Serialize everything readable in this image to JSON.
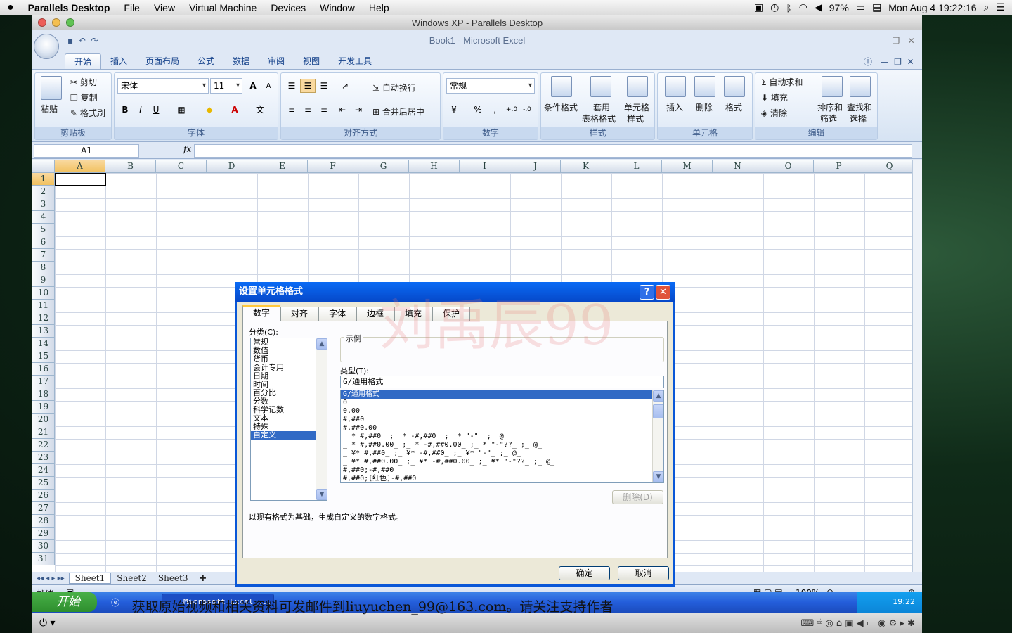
{
  "mac_menubar": {
    "app": "Parallels Desktop",
    "items": [
      "File",
      "View",
      "Virtual Machine",
      "Devices",
      "Window",
      "Help"
    ],
    "battery": "97%",
    "datetime": "Mon Aug 4  19:22:16"
  },
  "parallels": {
    "window_title": "Windows XP - Parallels Desktop"
  },
  "excel": {
    "title": "Book1 - Microsoft Excel",
    "tabs": [
      "开始",
      "插入",
      "页面布局",
      "公式",
      "数据",
      "审阅",
      "视图",
      "开发工具"
    ],
    "ribbon": {
      "clipboard": {
        "label": "剪贴板",
        "paste": "粘贴",
        "cut": "剪切",
        "copy": "复制",
        "format_painter": "格式刷"
      },
      "font": {
        "label": "字体",
        "family": "宋体",
        "size": "11",
        "bold": "B",
        "italic": "I",
        "underline": "U",
        "grow": "A",
        "shrink": "A"
      },
      "alignment": {
        "label": "对齐方式",
        "wrap": "自动换行",
        "merge": "合并后居中"
      },
      "number": {
        "label": "数字",
        "format": "常规",
        "percent": "%",
        "comma": ","
      },
      "styles": {
        "label": "样式",
        "conditional": "条件格式",
        "table_top": "套用",
        "table_bottom": "表格格式",
        "cell_top": "单元格",
        "cell_bottom": "样式"
      },
      "cells": {
        "label": "单元格",
        "insert": "插入",
        "delete": "删除",
        "format": "格式"
      },
      "editing": {
        "label": "编辑",
        "autosum": "自动求和",
        "fill": "填充",
        "clear": "清除",
        "sort_top": "排序和",
        "sort_bottom": "筛选",
        "find_top": "查找和",
        "find_bottom": "选择"
      }
    },
    "name_box": "A1",
    "fx": "fx",
    "columns": [
      "A",
      "B",
      "C",
      "D",
      "E",
      "F",
      "G",
      "H",
      "I",
      "J",
      "K",
      "L",
      "M",
      "N",
      "O",
      "P",
      "Q"
    ],
    "rows": [
      "1",
      "2",
      "3",
      "4",
      "5",
      "6",
      "7",
      "8",
      "9",
      "10",
      "11",
      "12",
      "13",
      "14",
      "15",
      "16",
      "17",
      "18",
      "19",
      "20",
      "21",
      "22",
      "23",
      "24",
      "25",
      "26",
      "27",
      "28",
      "29",
      "30",
      "31"
    ],
    "sheets": [
      "Sheet1",
      "Sheet2",
      "Sheet3"
    ],
    "status": "就绪",
    "zoom": "100%"
  },
  "dialog": {
    "title": "设置单元格格式",
    "tabs": [
      "数字",
      "对齐",
      "字体",
      "边框",
      "填充",
      "保护"
    ],
    "category_label": "分类(C):",
    "categories": [
      "常规",
      "数值",
      "货币",
      "会计专用",
      "日期",
      "时间",
      "百分比",
      "分数",
      "科学记数",
      "文本",
      "特殊",
      "自定义"
    ],
    "sample_label": "示例",
    "type_label": "类型(T):",
    "type_value": "G/通用格式",
    "types": [
      "G/通用格式",
      "0",
      "0.00",
      "#,##0",
      "#,##0.00",
      "_ * #,##0_ ;_ * -#,##0_ ;_ * \"-\"_ ;_ @_",
      "_ * #,##0.00_ ;_ * -#,##0.00_ ;_ * \"-\"??_ ;_ @_",
      "_ ¥* #,##0_ ;_ ¥* -#,##0_ ;_ ¥* \"-\"_ ;_ @_",
      "_ ¥* #,##0.00_ ;_ ¥* -#,##0.00_ ;_ ¥* \"-\"??_ ;_ @_",
      "#,##0;-#,##0",
      "#,##0;[红色]-#,##0"
    ],
    "delete_btn": "删除(D)",
    "description": "以现有格式为基础，生成自定义的数字格式。",
    "ok": "确定",
    "cancel": "取消",
    "watermark": "刘禹辰99"
  },
  "xp_taskbar": {
    "start": "开始",
    "item": "Microsoft Excel ...",
    "time": "19:22"
  },
  "caption": "获取原始视频和相关资料可发邮件到liuyuchen_99@163.com。请关注支持作者"
}
